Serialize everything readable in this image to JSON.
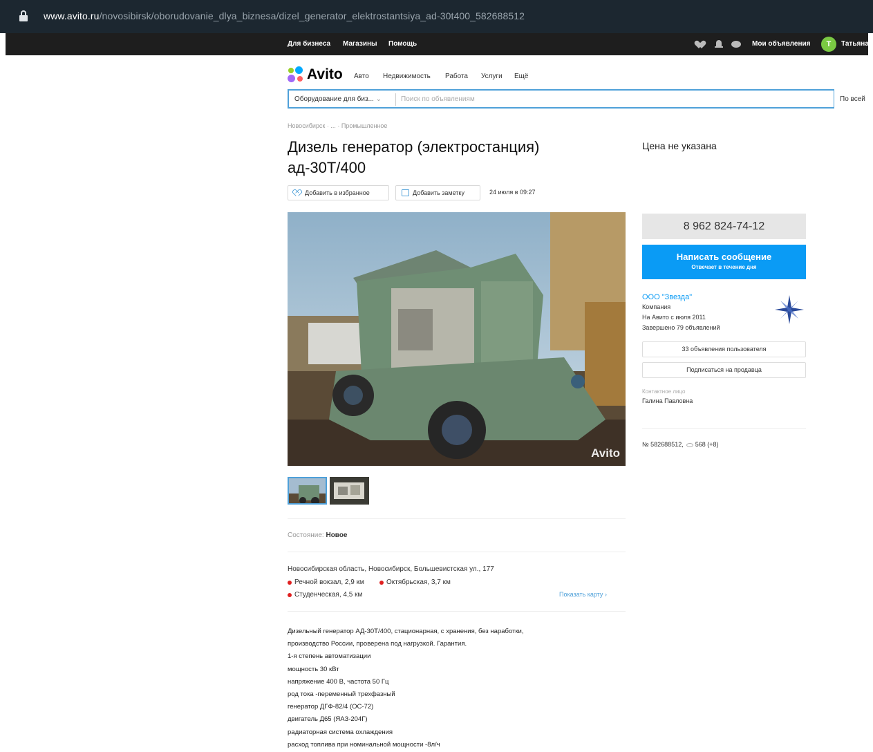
{
  "browser": {
    "url_host": "www.avito.ru",
    "url_path": "/novosibirsk/oborudovanie_dlya_biznesa/dizel_generator_elektrostantsiya_ad-30t400_582688512"
  },
  "topnav": {
    "links": [
      "Для бизнеса",
      "Магазины",
      "Помощь"
    ],
    "my_ads": "Мои объявления",
    "avatar_letter": "Т",
    "user_name": "Татьяна"
  },
  "logo": {
    "text": "Avito"
  },
  "catnav": [
    "Авто",
    "Недвижимость",
    "Работа",
    "Услуги",
    "Ещё"
  ],
  "search": {
    "category": "Оборудование для биз...",
    "placeholder": "Поиск по объявлениям",
    "region": "По всей"
  },
  "breadcrumbs": "Новосибирск · ... · Промышленное",
  "listing": {
    "title": "Дизель генератор (электростанция) ад-30Т/400",
    "price": "Цена не указана",
    "fav_button": "Добавить в избранное",
    "note_button": "Добавить заметку",
    "date": "24 июля в 09:27",
    "watermark": "Avito",
    "condition_label": "Состояние:",
    "condition_value": "Новое",
    "address": "Новосибирская область, Новосибирск, Большевистская ул., 177",
    "metro": [
      "Речной вокзал, 2,9 км",
      "Октябрьская, 3,7 км",
      "Студенческая, 4,5 км"
    ],
    "map_link": "Показать карту",
    "description": [
      "Дизельный генератор АД-30Т/400, стационарная, с хранения, без наработки,",
      "производство России, проверена под нагрузкой. Гарантия.",
      "1-я степень автоматизации",
      "мощность 30 кВт",
      "напряжение 400 В, частота 50 Гц",
      "род тока -переменный трехфазный",
      "генератор ДГФ-82/4 (ОС-72)",
      "двигатель Д65 (ЯАЗ-204Г)",
      "радиаторная система охлаждения",
      "расход топлива при номинальной мощности -8л/ч"
    ]
  },
  "seller": {
    "phone": "8 962 824-74-12",
    "message_button": "Написать сообщение",
    "message_sub": "Отвечает в течение дня",
    "name": "ООО \"Звезда\"",
    "type": "Компания",
    "since": "На Авито с июля 2011",
    "completed": "Завершено 79 объявлений",
    "ads_button": "33 объявления пользователя",
    "subscribe_button": "Подписаться на продавца",
    "contact_label": "Контактное лицо",
    "contact_name": "Галина Павловна",
    "ad_id": "№ 582688512,",
    "views": "568 (+8)"
  },
  "colors": {
    "accent": "#0a9bf5",
    "header": "#1e1e1e",
    "metro_dot": "#e02020"
  }
}
